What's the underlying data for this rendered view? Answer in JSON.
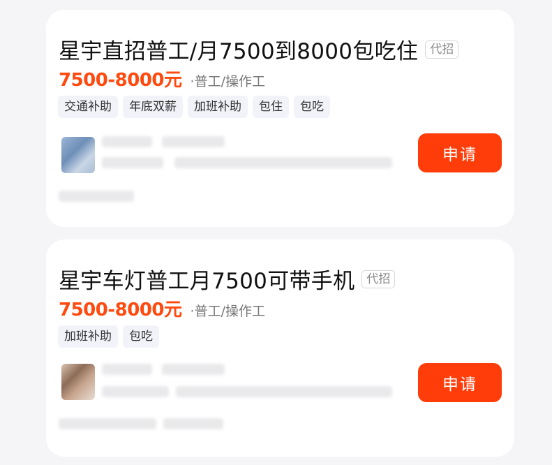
{
  "jobs": [
    {
      "title": "星宇直招普工/月7500到8000包吃住",
      "agent_label": "代招",
      "salary": "7500-8000元",
      "category": "·普工/操作工",
      "tags": [
        "交通补助",
        "年底双薪",
        "加班补助",
        "包住",
        "包吃"
      ],
      "apply_label": "申请"
    },
    {
      "title": "星宇车灯普工月7500可带手机",
      "agent_label": "代招",
      "salary": "7500-8000元",
      "category": "·普工/操作工",
      "tags": [
        "加班补助",
        "包吃"
      ],
      "apply_label": "申请"
    }
  ],
  "colors": {
    "salary": "#ff4a0f",
    "apply_button": "#ff3d0a",
    "background": "#f5f5f7",
    "tag_background": "#f1f3f8"
  }
}
